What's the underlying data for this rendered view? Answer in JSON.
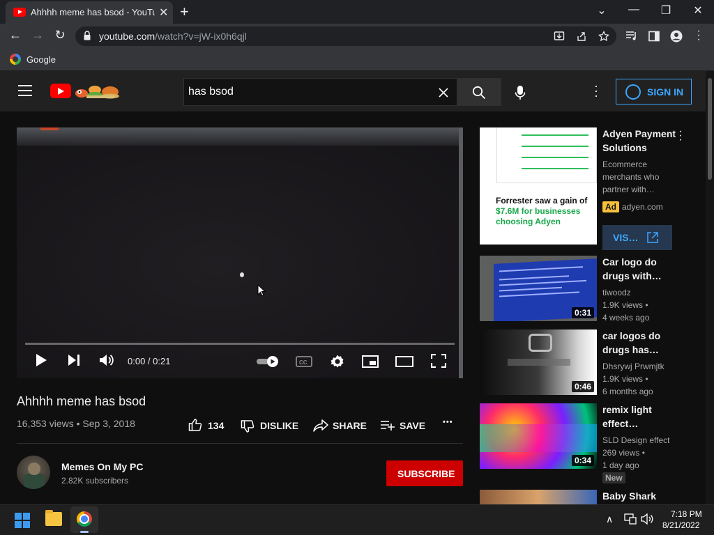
{
  "browser": {
    "tab_title": "Ahhhh meme has bsod - YouTube",
    "tab_close": "✕",
    "new_tab": "+",
    "window_controls": {
      "tab_search": "⌄",
      "minimize": "—",
      "restore": "❐",
      "close": "✕"
    },
    "url_host": "youtube.com",
    "url_path": "/watch?v=jW-ix0h6qjl",
    "bookmark": "Google",
    "nav": {
      "back": "←",
      "forward": "→",
      "reload": "↻"
    }
  },
  "header": {
    "search_value": "has bsod",
    "sign_in": "SIGN IN"
  },
  "player": {
    "time": "0:00 / 0:21",
    "progress": 0
  },
  "video": {
    "title": "Ahhhh meme has bsod",
    "views_date": "16,353 views • Sep 3, 2018",
    "likes": "134",
    "dislike": "DISLIKE",
    "share": "SHARE",
    "save": "SAVE",
    "more": "•••"
  },
  "channel": {
    "name": "Memes On My PC",
    "subscribers": "2.82K subscribers",
    "subscribe": "SUBSCRIBE"
  },
  "ad": {
    "thumb_text_1": "Forrester saw a gain of ",
    "thumb_text_highlight": "$7.6M for businesses choosing Adyen",
    "title": "Adyen Payment Solutions",
    "description": "Ecommerce merchants who partner with…",
    "badge": "Ad",
    "domain": "adyen.com",
    "visit": "VIS…"
  },
  "related": [
    {
      "title": "Car logo do drugs with…",
      "channel": "tiwoodz",
      "views": "1.9K views •",
      "age": "4 weeks ago",
      "duration": "0:31"
    },
    {
      "title": "car logos do drugs has…",
      "channel": "Dhsrywj Prwmjtk",
      "views": "1.9K views •",
      "age": "6 months ago",
      "duration": "0:46"
    },
    {
      "title": "remix light effect…",
      "channel": "SLD Design effect",
      "views": "269 views •",
      "age": "1 day ago",
      "duration": "0:34",
      "badge": "New"
    },
    {
      "title": "Baby Shark"
    }
  ],
  "taskbar": {
    "time": "7:18 PM",
    "date": "8/21/2022",
    "tray_chevron": "∧"
  }
}
